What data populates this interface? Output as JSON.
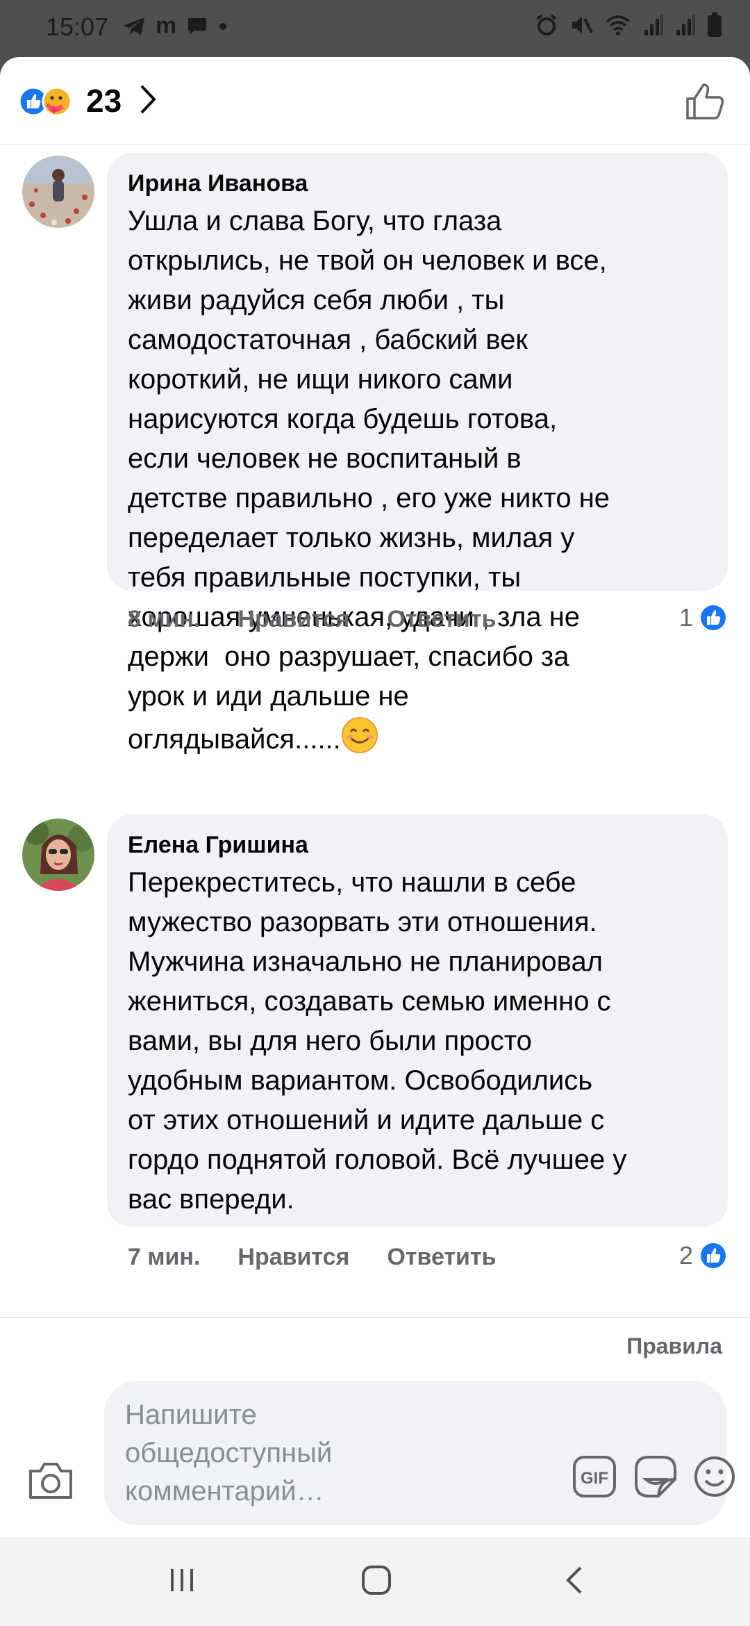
{
  "status_bar": {
    "time": "15:07",
    "left_icons": [
      "telegram-icon",
      "m-app-icon",
      "message-icon",
      "dot-icon"
    ],
    "right_icons": [
      "alarm-icon",
      "mute-icon",
      "wifi-off-icon",
      "signal-icon",
      "signal-icon",
      "battery-icon"
    ]
  },
  "reactions_header": {
    "icons": [
      "like-reaction-icon",
      "care-reaction-icon"
    ],
    "count": "23"
  },
  "comments": [
    {
      "author": "Ирина Иванова",
      "text": "Ушла и слава Богу, что глаза\nоткрылись, не твой он человек и все,\nживи радуйся себя люби , ты\nсамодостаточная , бабский век\nкороткий, не ищи никого сами\nнарисуются когда будешь готова,\nесли человек не воспитаный в\nдетстве правильно , его уже никто не\nпеределает только жизнь, милая у\nтебя правильные поступки, ты\nхорошая умненькая, удачи , зла не\nдержи  оно разрушает, спасибо за\nурок и иди дальше не\nоглядывайся......",
      "emoji": "smiling-face-emoji",
      "time": "8 мин.",
      "like_label": "Нравится",
      "reply_label": "Ответить",
      "reaction_count": "1"
    },
    {
      "author": "Елена Гришина",
      "text": "Перекреститесь, что нашли в себе\nмужество разорвать эти отношения.\nМужчина изначально не планировал\nжениться, создавать семью именно с\nвами, вы для него были просто\nудобным вариантом. Освободились\nот этих отношений и идите дальше с\nгордо поднятой головой. Всё лучшее у\nвас впереди.",
      "time": "7 мин.",
      "like_label": "Нравится",
      "reply_label": "Ответить",
      "reaction_count": "2"
    }
  ],
  "composer": {
    "rules_label": "Правила",
    "placeholder": "Напишите\nобщедоступный\nкомментарий…",
    "icons": [
      "camera-icon",
      "gif-icon",
      "sticker-icon",
      "emoji-icon"
    ]
  },
  "nav_bar": {
    "icons": [
      "recents-icon",
      "home-icon",
      "back-icon"
    ]
  },
  "colors": {
    "like_blue": "#1877f2",
    "bubble_bg": "#f0f2f5",
    "meta_gray": "#65676b",
    "status_bg": "#4f4f4f"
  }
}
